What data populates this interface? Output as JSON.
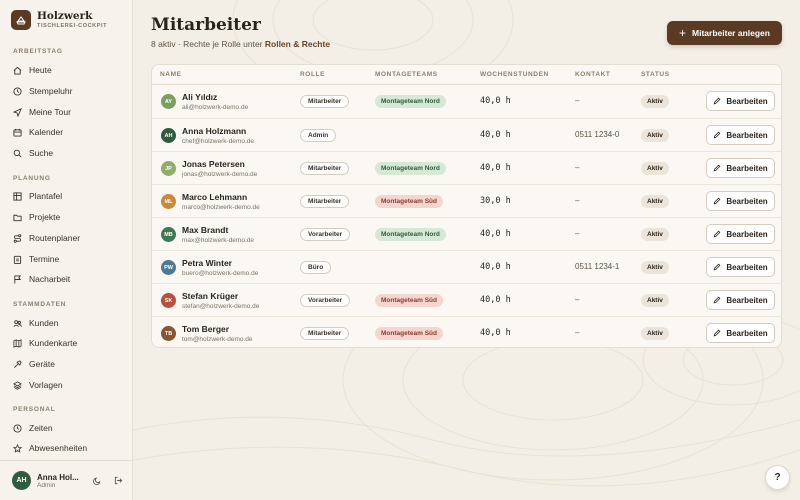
{
  "brand": {
    "name": "Holzwerk",
    "subtitle": "TISCHLEREI-COCKPIT"
  },
  "sidebar": {
    "sections": [
      {
        "label": "ARBEITSTAG",
        "items": [
          {
            "label": "Heute",
            "icon": "home-icon"
          },
          {
            "label": "Stempeluhr",
            "icon": "clock-icon"
          },
          {
            "label": "Meine Tour",
            "icon": "send-icon"
          },
          {
            "label": "Kalender",
            "icon": "calendar-icon"
          },
          {
            "label": "Suche",
            "icon": "search-icon"
          }
        ]
      },
      {
        "label": "PLANUNG",
        "items": [
          {
            "label": "Plantafel",
            "icon": "grid-icon"
          },
          {
            "label": "Projekte",
            "icon": "folder-icon"
          },
          {
            "label": "Routenplaner",
            "icon": "route-icon"
          },
          {
            "label": "Termine",
            "icon": "clipboard-icon"
          },
          {
            "label": "Nacharbeit",
            "icon": "flag-icon"
          }
        ]
      },
      {
        "label": "STAMMDATEN",
        "items": [
          {
            "label": "Kunden",
            "icon": "users-icon"
          },
          {
            "label": "Kundenkarte",
            "icon": "map-icon"
          },
          {
            "label": "Geräte",
            "icon": "hammer-icon"
          },
          {
            "label": "Vorlagen",
            "icon": "layers-icon"
          }
        ]
      },
      {
        "label": "PERSONAL",
        "items": [
          {
            "label": "Zeiten",
            "icon": "clock-icon"
          },
          {
            "label": "Abwesenheiten",
            "icon": "star-icon"
          }
        ]
      }
    ],
    "user": {
      "initials": "AH",
      "name": "Anna Hol...",
      "role": "Admin"
    }
  },
  "header": {
    "title": "Mitarbeiter",
    "subtitle_prefix": "8 aktiv · Rechte je Rolle unter",
    "subtitle_link": "Rollen & Rechte",
    "add_button": "Mitarbeiter anlegen"
  },
  "table": {
    "columns": [
      "NAME",
      "ROLLE",
      "MONTAGETEAMS",
      "WOCHENSTUNDEN",
      "KONTAKT",
      "STATUS"
    ],
    "edit_label": "Bearbeiten",
    "rows": [
      {
        "initials": "AY",
        "avatar_color": "#7aa05e",
        "name": "Ali Yıldız",
        "email": "ali@holzwerk-demo.de",
        "role": "Mitarbeiter",
        "team": "Montageteam Nord",
        "team_type": "nord",
        "hours": "40,0 h",
        "contact": "–",
        "status": "Aktiv"
      },
      {
        "initials": "AH",
        "avatar_color": "#2f5b3f",
        "name": "Anna Holzmann",
        "email": "chef@holzwerk-demo.de",
        "role": "Admin",
        "team": "",
        "team_type": "",
        "hours": "40,0 h",
        "contact": "0511 1234-0",
        "status": "Aktiv"
      },
      {
        "initials": "JP",
        "avatar_color": "#8fae6e",
        "name": "Jonas Petersen",
        "email": "jonas@holzwerk-demo.de",
        "role": "Mitarbeiter",
        "team": "Montageteam Nord",
        "team_type": "nord",
        "hours": "40,0 h",
        "contact": "–",
        "status": "Aktiv"
      },
      {
        "initials": "ML",
        "avatar_color": "#c98a3c",
        "name": "Marco Lehmann",
        "email": "marco@holzwerk-demo.de",
        "role": "Mitarbeiter",
        "team": "Montageteam Süd",
        "team_type": "sued",
        "hours": "30,0 h",
        "contact": "–",
        "status": "Aktiv"
      },
      {
        "initials": "MB",
        "avatar_color": "#3d7a52",
        "name": "Max Brandt",
        "email": "max@holzwerk-demo.de",
        "role": "Vorarbeiter",
        "team": "Montageteam Nord",
        "team_type": "nord",
        "hours": "40,0 h",
        "contact": "–",
        "status": "Aktiv"
      },
      {
        "initials": "PW",
        "avatar_color": "#4e7a96",
        "name": "Petra Winter",
        "email": "buero@holzwerk-demo.de",
        "role": "Büro",
        "team": "",
        "team_type": "",
        "hours": "40,0 h",
        "contact": "0511 1234-1",
        "status": "Aktiv"
      },
      {
        "initials": "SK",
        "avatar_color": "#b5513c",
        "name": "Stefan Krüger",
        "email": "stefan@holzwerk-demo.de",
        "role": "Vorarbeiter",
        "team": "Montageteam Süd",
        "team_type": "sued",
        "hours": "40,0 h",
        "contact": "–",
        "status": "Aktiv"
      },
      {
        "initials": "TB",
        "avatar_color": "#8a5432",
        "name": "Tom Berger",
        "email": "tom@holzwerk-demo.de",
        "role": "Mitarbeiter",
        "team": "Montageteam Süd",
        "team_type": "sued",
        "hours": "40,0 h",
        "contact": "–",
        "status": "Aktiv"
      }
    ]
  },
  "help": {
    "label": "?"
  },
  "colors": {
    "accent": "#5a3a23",
    "sidebar_bg": "#f7f3ec",
    "page_bg": "#f4efe6"
  }
}
